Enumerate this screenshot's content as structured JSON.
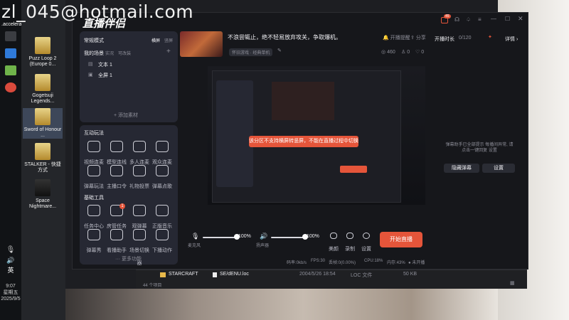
{
  "watermark": "zl_045@hotmail.com",
  "taskbar": {
    "lang": "英",
    "time": "9:07",
    "weekday": "星期五",
    "date": "2025/9/5",
    "accelerate": ".accelerate"
  },
  "desktop_icons": [
    {
      "label": "Puzz Loop 2 (Europe 0..."
    },
    {
      "label": "Gogetsuji Legends..."
    },
    {
      "label": "Sword of Honour ..."
    },
    {
      "label": "STALKER - 快捷方式"
    },
    {
      "label": "Space Nightmare..."
    }
  ],
  "app": {
    "logo": "直播伴侣",
    "mode_label": "常规模式",
    "mode_tabs": [
      "横屏",
      "竖屏"
    ],
    "scene_tabs": [
      "我的场景",
      "实况",
      "可改装"
    ],
    "sources": [
      "文本 1",
      "全屏 1"
    ],
    "add_source": "+ 添加素材",
    "interact_title": "互动玩法",
    "interact_items": [
      "视频连麦",
      "模型连线",
      "多人连麦",
      "观众连麦",
      "弹幕玩法",
      "主播口令",
      "礼物投票",
      "弹幕点歌"
    ],
    "tools_title": "基础工具",
    "tools_items": [
      "任务中心",
      "房管任务",
      "观弹幕",
      "正版音乐",
      "弹幕秀",
      "看播助手",
      "场景切换器",
      "下播动作"
    ],
    "tools_badge": "1",
    "more": "··· 更多功能",
    "stream_title": "不浪尝辄止，绝不轻易放弃攻关，争取爆机。",
    "category": "怀旧游戏 · 经典单机",
    "stats": {
      "viewers": "460",
      "likes": "0",
      "gifts": "0"
    },
    "top_actions": [
      "开播提醒",
      "分享"
    ],
    "stream_time_label": "开播时长",
    "stream_time_value": "0/120",
    "detail_btn": "详情 ›",
    "notify_badge": "45",
    "danmaku_notice": "弹幕助手已全部提示 每播间异常, 请点击一键回复 设置",
    "danmaku_buttons": [
      "隐藏弹幕",
      "设置"
    ],
    "toast": "该分区不支持横屏转竖屏，不能在直播过程中切换",
    "mic_label": "麦克风",
    "speaker_label": "扬声器",
    "mic_value": "100%",
    "speaker_value": "100%",
    "bottom_actions": [
      "美颜",
      "录制",
      "设置"
    ],
    "start_button": "开始直播",
    "status": {
      "bitrate": "码率:0kb/s",
      "fps": "FPS:30",
      "drop": "丢帧:0(0.00%)",
      "cpu": "CPU:18%",
      "mem": "内存:43%",
      "state": "● 未开播"
    }
  },
  "explorer": {
    "folder": "STARCRAFT",
    "file": "SE/dENU.loc",
    "file_date": "2004/5/26 18:54",
    "file_type": "LOC 文件",
    "file_size": "50 KB",
    "count": "44 个项目"
  },
  "colors": {
    "accent": "#e5553a",
    "panel": "#262833",
    "bg": "#16171b"
  }
}
